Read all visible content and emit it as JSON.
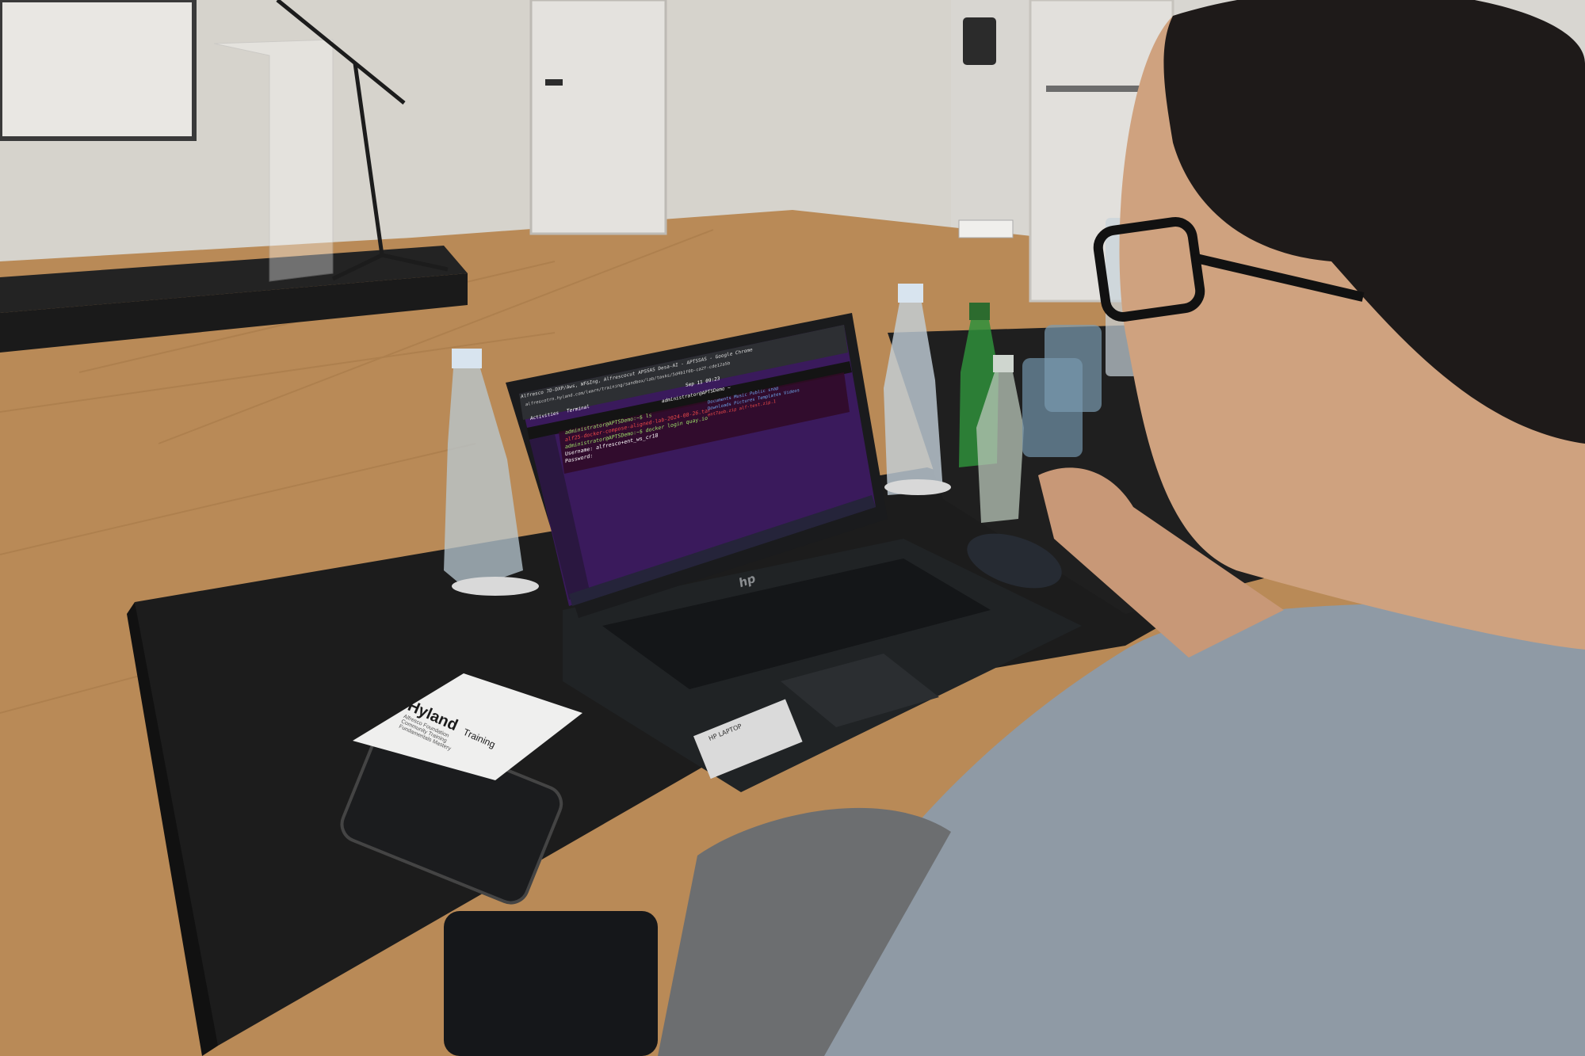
{
  "scene": {
    "screen": {
      "window_title": "Alfresco 7D-DXP/Aws, WF&Ing, Alfrescocut APSSAS Desa-AI - APTSSAS - Google Chrome",
      "address_bar": "alfrescotrn.hyland.com/learn/training/sandbox/lab/tasks/5d4b1f0b-ca2f-cde12a5b",
      "clock": "Sep 11 09:23",
      "activities": "Activities",
      "terminal_app": "Terminal",
      "terminal_title": "administrator@APTSDemo ~",
      "terminal_lines": [
        "administrator@APTSDemo:~$ ls",
        "alf25-docker-compose-aligned-lab-2024-08-26.tar",
        "administrator@APTSDemo:~$ docker login quay.io",
        "Username: alfresco+ent_ws_cr18",
        "Password:"
      ],
      "right_listing": [
        "Documents  Music     Public   snap",
        "Downloads  Pictures  Templates  Videos",
        "ent7aob.zip  alf-test.zip.1"
      ]
    },
    "laptop": {
      "brand_logo": "hp",
      "sticker": "HP LAPTOP"
    },
    "card": {
      "brand": "Hyland",
      "title": "Training",
      "lines": [
        "Alfresco Foundation",
        "Community Training",
        "Fundamentals Mastery"
      ]
    },
    "colors": {
      "wall": "#d9d6cf",
      "floor": "#b8895a",
      "table": "#1f1f1f",
      "terminal_bg": "#3a1a5c",
      "shirt": "#8e9aa6"
    }
  }
}
